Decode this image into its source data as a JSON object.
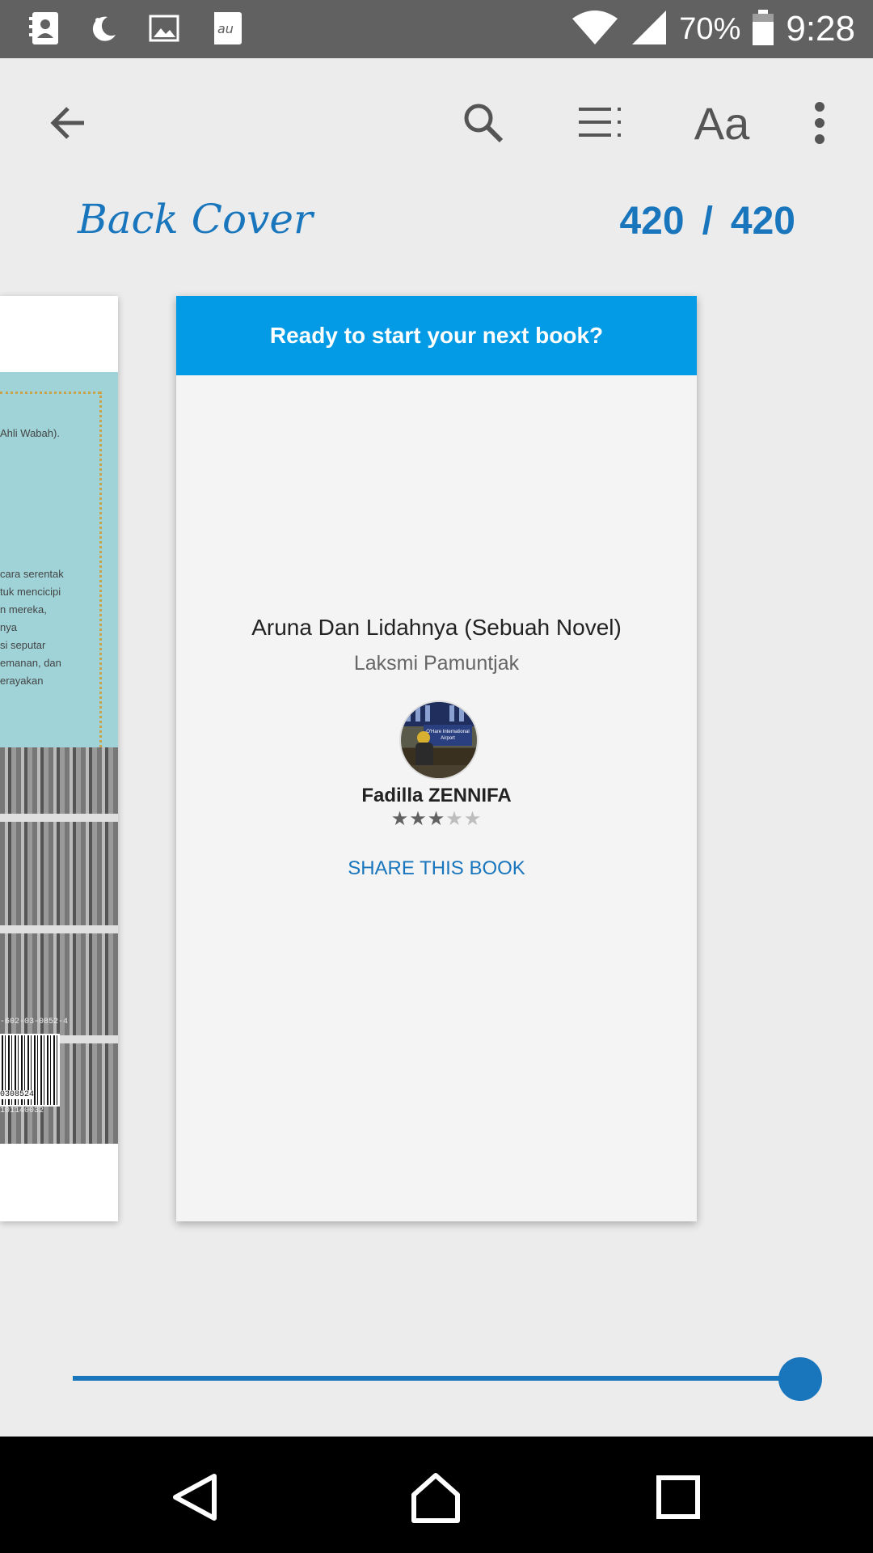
{
  "status_bar": {
    "battery_percent": "70%",
    "time": "9:28",
    "left_icons": [
      "contacts-notification-icon",
      "night-mode-icon",
      "image-notification-icon",
      "au-app-icon"
    ],
    "right_icons": [
      "wifi-icon",
      "signal-icon",
      "battery-icon"
    ]
  },
  "toolbar": {
    "back_icon": "arrow-left-icon",
    "search_icon": "search-icon",
    "contents_icon": "table-of-contents-icon",
    "display_label": "Aa",
    "more_icon": "more-vertical-icon"
  },
  "reader": {
    "chapter": "Back Cover",
    "current_page": "420",
    "separator": "/",
    "total_pages": "420"
  },
  "cover_snippet": {
    "lines": [
      "Ahli Wabah).",
      "cara serentak",
      "tuk mencicipi",
      "n mereka,",
      "nya",
      "si seputar",
      "emanan, dan",
      "erayakan"
    ],
    "isbn_top": "-602-03-0852-4",
    "barcode_num": "0308524",
    "isbn_bottom": "101140032"
  },
  "end_card": {
    "header": "Ready to start your next book?",
    "book_title": "Aruna Dan Lidahnya (Sebuah Novel)",
    "author": "Laksmi Pamuntjak",
    "avatar_caption_line1": "O'Hare International",
    "avatar_caption_line2": "Airport",
    "reviewer": "Fadilla ZENNIFA",
    "rating": 3,
    "rating_max": 5,
    "share_label": "SHARE THIS BOOK"
  },
  "slider": {
    "progress_fraction": 1.0
  },
  "colors": {
    "accent": "#1976bd",
    "header_blue": "#039be5",
    "status_bar": "#616161",
    "background": "#ececec"
  }
}
